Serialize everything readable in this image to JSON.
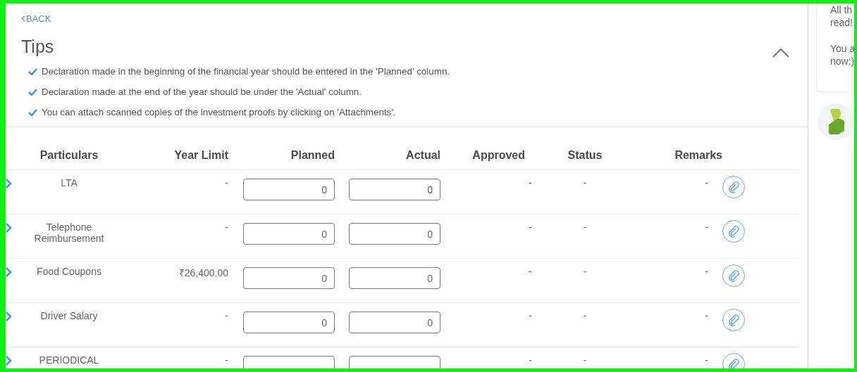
{
  "back_link": {
    "label": "BACK"
  },
  "title": "Tips",
  "tips_expanded": true,
  "tips": [
    "Declaration made in the beginning of the financial year should be entered in the 'Planned' column.",
    "Declaration made at the end of the year should be under the 'Actual' column.",
    "You can attach scanned copies of the investment proofs by clicking on 'Attachments'."
  ],
  "table": {
    "columns": [
      "Particulars",
      "Year Limit",
      "Planned",
      "Actual",
      "Approved",
      "Status",
      "Remarks"
    ],
    "rows": [
      {
        "particulars": "LTA",
        "year_limit": "-",
        "planned": "0",
        "actual": "0",
        "approved": "-",
        "status": "-",
        "remarks": "-"
      },
      {
        "particulars": "Telephone Reimbursement",
        "year_limit": "-",
        "planned": "0",
        "actual": "0",
        "approved": "-",
        "status": "-",
        "remarks": "-"
      },
      {
        "particulars": "Food Coupons",
        "year_limit": "₹26,400.00",
        "planned": "0",
        "actual": "0",
        "approved": "-",
        "status": "-",
        "remarks": "-"
      },
      {
        "particulars": "Driver Salary",
        "year_limit": "-",
        "planned": "0",
        "actual": "0",
        "approved": "-",
        "status": "-",
        "remarks": "-"
      },
      {
        "particulars": "PERIODICAL",
        "year_limit": "-",
        "approved": "-",
        "status": "-",
        "remarks": "-"
      }
    ]
  },
  "chat": {
    "messages": [
      "All th\nread!",
      "You a\nnow:)"
    ]
  }
}
